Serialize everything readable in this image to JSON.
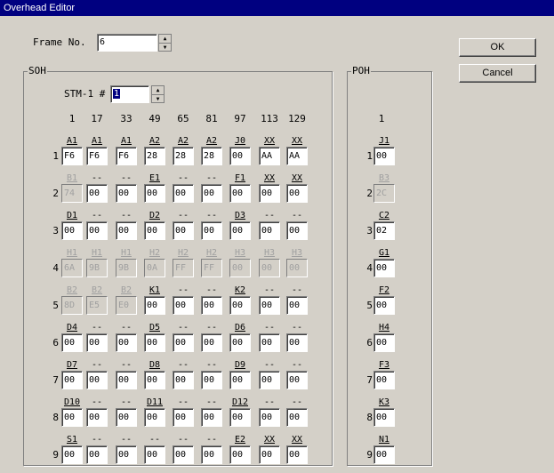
{
  "window": {
    "title": "Overhead Editor"
  },
  "frame": {
    "label": "Frame No.",
    "value": "6"
  },
  "buttons": {
    "ok": "OK",
    "cancel": "Cancel"
  },
  "soh": {
    "title": "SOH",
    "stm_label": "STM-1 #",
    "stm_value": "1",
    "columns": [
      "1",
      "17",
      "33",
      "49",
      "65",
      "81",
      "97",
      "113",
      "129"
    ],
    "rows": [
      {
        "num": "1",
        "cells": [
          {
            "l": "A1",
            "v": "F6",
            "d": false
          },
          {
            "l": "A1",
            "v": "F6",
            "d": false
          },
          {
            "l": "A1",
            "v": "F6",
            "d": false
          },
          {
            "l": "A2",
            "v": "28",
            "d": false
          },
          {
            "l": "A2",
            "v": "28",
            "d": false
          },
          {
            "l": "A2",
            "v": "28",
            "d": false
          },
          {
            "l": "J0",
            "v": "00",
            "d": false
          },
          {
            "l": "XX",
            "v": "AA",
            "d": false
          },
          {
            "l": "XX",
            "v": "AA",
            "d": false
          }
        ]
      },
      {
        "num": "2",
        "cells": [
          {
            "l": "B1",
            "v": "74",
            "d": true
          },
          {
            "l": "--",
            "v": "00",
            "d": false
          },
          {
            "l": "--",
            "v": "00",
            "d": false
          },
          {
            "l": "E1",
            "v": "00",
            "d": false
          },
          {
            "l": "--",
            "v": "00",
            "d": false
          },
          {
            "l": "--",
            "v": "00",
            "d": false
          },
          {
            "l": "F1",
            "v": "00",
            "d": false
          },
          {
            "l": "XX",
            "v": "00",
            "d": false
          },
          {
            "l": "XX",
            "v": "00",
            "d": false
          }
        ]
      },
      {
        "num": "3",
        "cells": [
          {
            "l": "D1",
            "v": "00",
            "d": false
          },
          {
            "l": "--",
            "v": "00",
            "d": false
          },
          {
            "l": "--",
            "v": "00",
            "d": false
          },
          {
            "l": "D2",
            "v": "00",
            "d": false
          },
          {
            "l": "--",
            "v": "00",
            "d": false
          },
          {
            "l": "--",
            "v": "00",
            "d": false
          },
          {
            "l": "D3",
            "v": "00",
            "d": false
          },
          {
            "l": "--",
            "v": "00",
            "d": false
          },
          {
            "l": "--",
            "v": "00",
            "d": false
          }
        ]
      },
      {
        "num": "4",
        "cells": [
          {
            "l": "H1",
            "v": "6A",
            "d": true
          },
          {
            "l": "H1",
            "v": "9B",
            "d": true
          },
          {
            "l": "H1",
            "v": "9B",
            "d": true
          },
          {
            "l": "H2",
            "v": "0A",
            "d": true
          },
          {
            "l": "H2",
            "v": "FF",
            "d": true
          },
          {
            "l": "H2",
            "v": "FF",
            "d": true
          },
          {
            "l": "H3",
            "v": "00",
            "d": true
          },
          {
            "l": "H3",
            "v": "00",
            "d": true
          },
          {
            "l": "H3",
            "v": "00",
            "d": true
          }
        ]
      },
      {
        "num": "5",
        "cells": [
          {
            "l": "B2",
            "v": "8D",
            "d": true
          },
          {
            "l": "B2",
            "v": "E5",
            "d": true
          },
          {
            "l": "B2",
            "v": "E0",
            "d": true
          },
          {
            "l": "K1",
            "v": "00",
            "d": false
          },
          {
            "l": "--",
            "v": "00",
            "d": false
          },
          {
            "l": "--",
            "v": "00",
            "d": false
          },
          {
            "l": "K2",
            "v": "00",
            "d": false
          },
          {
            "l": "--",
            "v": "00",
            "d": false
          },
          {
            "l": "--",
            "v": "00",
            "d": false
          }
        ]
      },
      {
        "num": "6",
        "cells": [
          {
            "l": "D4",
            "v": "00",
            "d": false
          },
          {
            "l": "--",
            "v": "00",
            "d": false
          },
          {
            "l": "--",
            "v": "00",
            "d": false
          },
          {
            "l": "D5",
            "v": "00",
            "d": false
          },
          {
            "l": "--",
            "v": "00",
            "d": false
          },
          {
            "l": "--",
            "v": "00",
            "d": false
          },
          {
            "l": "D6",
            "v": "00",
            "d": false
          },
          {
            "l": "--",
            "v": "00",
            "d": false
          },
          {
            "l": "--",
            "v": "00",
            "d": false
          }
        ]
      },
      {
        "num": "7",
        "cells": [
          {
            "l": "D7",
            "v": "00",
            "d": false
          },
          {
            "l": "--",
            "v": "00",
            "d": false
          },
          {
            "l": "--",
            "v": "00",
            "d": false
          },
          {
            "l": "D8",
            "v": "00",
            "d": false
          },
          {
            "l": "--",
            "v": "00",
            "d": false
          },
          {
            "l": "--",
            "v": "00",
            "d": false
          },
          {
            "l": "D9",
            "v": "00",
            "d": false
          },
          {
            "l": "--",
            "v": "00",
            "d": false
          },
          {
            "l": "--",
            "v": "00",
            "d": false
          }
        ]
      },
      {
        "num": "8",
        "cells": [
          {
            "l": "D10",
            "v": "00",
            "d": false
          },
          {
            "l": "--",
            "v": "00",
            "d": false
          },
          {
            "l": "--",
            "v": "00",
            "d": false
          },
          {
            "l": "D11",
            "v": "00",
            "d": false
          },
          {
            "l": "--",
            "v": "00",
            "d": false
          },
          {
            "l": "--",
            "v": "00",
            "d": false
          },
          {
            "l": "D12",
            "v": "00",
            "d": false
          },
          {
            "l": "--",
            "v": "00",
            "d": false
          },
          {
            "l": "--",
            "v": "00",
            "d": false
          }
        ]
      },
      {
        "num": "9",
        "cells": [
          {
            "l": "S1",
            "v": "00",
            "d": false
          },
          {
            "l": "--",
            "v": "00",
            "d": false
          },
          {
            "l": "--",
            "v": "00",
            "d": false
          },
          {
            "l": "--",
            "v": "00",
            "d": false
          },
          {
            "l": "--",
            "v": "00",
            "d": false
          },
          {
            "l": "--",
            "v": "00",
            "d": false
          },
          {
            "l": "E2",
            "v": "00",
            "d": false
          },
          {
            "l": "XX",
            "v": "00",
            "d": false
          },
          {
            "l": "XX",
            "v": "00",
            "d": false
          }
        ]
      }
    ]
  },
  "poh": {
    "title": "POH",
    "column": "1",
    "rows": [
      {
        "num": "1",
        "l": "J1",
        "v": "00",
        "d": false
      },
      {
        "num": "2",
        "l": "B3",
        "v": "2C",
        "d": true
      },
      {
        "num": "3",
        "l": "C2",
        "v": "02",
        "d": false
      },
      {
        "num": "4",
        "l": "G1",
        "v": "00",
        "d": false
      },
      {
        "num": "5",
        "l": "F2",
        "v": "00",
        "d": false
      },
      {
        "num": "6",
        "l": "H4",
        "v": "00",
        "d": false
      },
      {
        "num": "7",
        "l": "F3",
        "v": "00",
        "d": false
      },
      {
        "num": "8",
        "l": "K3",
        "v": "00",
        "d": false
      },
      {
        "num": "9",
        "l": "N1",
        "v": "00",
        "d": false
      }
    ]
  }
}
